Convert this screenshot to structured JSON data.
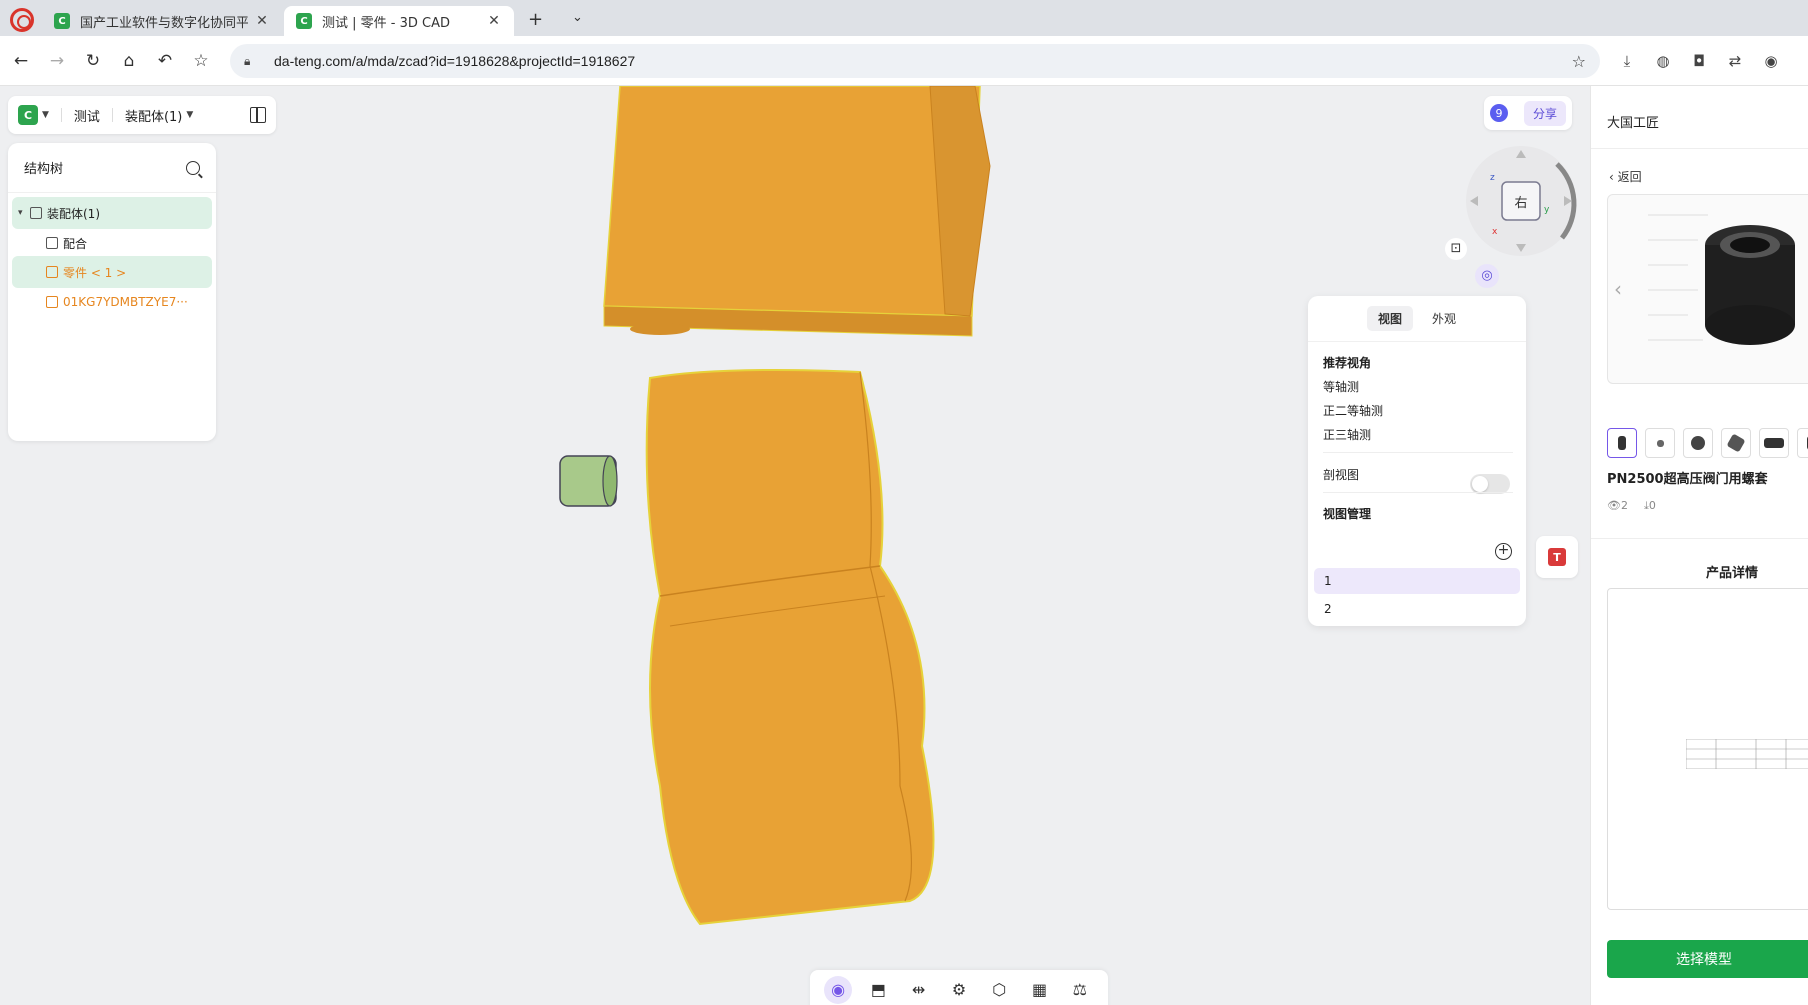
{
  "browser": {
    "tabs": [
      {
        "title": "国产工业软件与数字化协同平",
        "active": false
      },
      {
        "title": "测试 | 零件 - 3D CAD",
        "active": true
      }
    ],
    "url": "da-teng.com/a/mda/zcad?id=1918628&projectId=1918627"
  },
  "toolbar": {
    "project": "测试",
    "assembly": "装配体(1)"
  },
  "tree": {
    "title": "结构树",
    "items": [
      {
        "label": "装配体(1)",
        "level": 0
      },
      {
        "label": "配合",
        "level": 1
      },
      {
        "label": "零件 < 1 >",
        "level": 1
      },
      {
        "label": "01KG7YDMBTZYE7···",
        "level": 1
      }
    ]
  },
  "top_right": {
    "badge": "9",
    "share": "分享"
  },
  "nav_cube": {
    "face": "右",
    "axes": [
      "z",
      "x",
      "y"
    ]
  },
  "view_panel": {
    "tabs": [
      "视图",
      "外观"
    ],
    "recommended_title": "推荐视角",
    "recommended": [
      "等轴测",
      "正二等轴测",
      "正三轴测"
    ],
    "section_view": "剖视图",
    "manage_title": "视图管理",
    "views": [
      "1",
      "2"
    ]
  },
  "side": {
    "title": "大国工匠",
    "back": "返回",
    "product_name": "PN2500超高压阀门用螺套",
    "views_count": "2",
    "downloads_count": "0",
    "detail_title": "产品详情",
    "select_button": "选择模型"
  },
  "colors": {
    "accent": "#7557e8",
    "model": "#e8a235",
    "green": "#1aa64b"
  },
  "icons": {
    "bottom_tools": [
      "orbit-icon",
      "box-open-icon",
      "mate-icon",
      "settings-icon",
      "cube-icon",
      "measure-icon",
      "balance-icon"
    ]
  }
}
